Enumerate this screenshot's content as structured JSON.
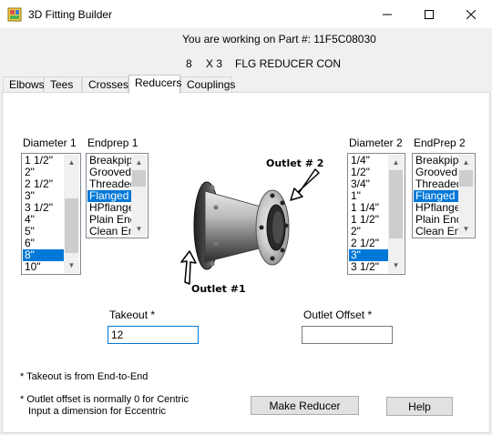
{
  "window": {
    "title": "3D Fitting Builder",
    "min_glyph": "—",
    "max_glyph": "☐",
    "close_glyph": "✕"
  },
  "header": {
    "part_line": "You are working on Part #: 11F5C08030",
    "size_a": "8",
    "size_x": "X 3",
    "fitting_name": "FLG REDUCER CON"
  },
  "tabs": [
    {
      "label": "Elbows"
    },
    {
      "label": "Tees"
    },
    {
      "label": "Crosses"
    },
    {
      "label": "Reducers",
      "active": true
    },
    {
      "label": "Couplings"
    }
  ],
  "diameter1": {
    "label": "Diameter 1",
    "items": [
      "1 1/2\"",
      "2\"",
      "2 1/2\"",
      "3\"",
      "3 1/2\"",
      "4\"",
      "5\"",
      "6\"",
      "8\"",
      "10\""
    ],
    "selected": "8\""
  },
  "endprep1": {
    "label": "Endprep 1",
    "items": [
      "Breakpipe",
      "Grooved",
      "Threaded",
      "Flanged",
      "HPflanged",
      "Plain End",
      "Clean End"
    ],
    "selected": "Flanged"
  },
  "diameter2": {
    "label": "Diameter 2",
    "items": [
      "1/4\"",
      "1/2\"",
      "3/4\"",
      "1\"",
      "1 1/4\"",
      "1 1/2\"",
      "2\"",
      "2 1/2\"",
      "3\"",
      "3 1/2\""
    ],
    "selected": "3\""
  },
  "endprep2": {
    "label": "EndPrep 2",
    "items": [
      "Breakpipe",
      "Grooved",
      "Threaded",
      "Flanged",
      "HPflanged",
      "Plain End",
      "Clean End"
    ],
    "selected": "Flanged"
  },
  "diagram": {
    "outlet1_label": "Outlet #1",
    "outlet2_label": "Outlet # 2"
  },
  "takeout": {
    "label": "Takeout *",
    "value": "12"
  },
  "outlet_offset": {
    "label": "Outlet Offset *",
    "value": ""
  },
  "notes": {
    "takeout_note": "* Takeout is from End-to-End",
    "offset_note_1": "* Outlet offset is normally 0 for Centric",
    "offset_note_2": "Input a dimension for Eccentric"
  },
  "buttons": {
    "make": "Make Reducer",
    "help": "Help"
  },
  "colors": {
    "selection": "#0078d7",
    "window_bg": "#f0f0f0"
  }
}
